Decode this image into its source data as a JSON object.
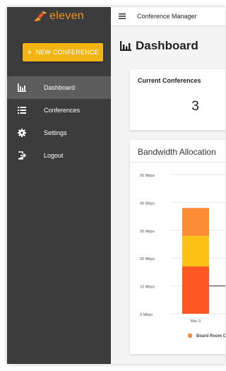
{
  "app": {
    "logo_text": "eleven",
    "title": "Conference Manager"
  },
  "sidebar": {
    "new_button_label": "NEW CONFERENCE",
    "items": [
      {
        "label": "Dashboard",
        "icon": "bar-chart-icon",
        "active": true
      },
      {
        "label": "Conferences",
        "icon": "list-icon",
        "active": false
      },
      {
        "label": "Settings",
        "icon": "gear-icon",
        "active": false
      },
      {
        "label": "Logout",
        "icon": "logout-icon",
        "active": false
      }
    ]
  },
  "page": {
    "title": "Dashboard"
  },
  "cards": {
    "current": {
      "title": "Current Conferences",
      "value": "3"
    },
    "bandwidth": {
      "title": "Bandwidth Allocation"
    }
  },
  "chart_data": {
    "type": "bar",
    "stacked": true,
    "title": "Bandwidth Allocation",
    "categories": [
      "Mar 3"
    ],
    "y_ticks": [
      "0 Mbps",
      "10 Mbps",
      "20 Mbps",
      "30 Mbps",
      "40 Mbps",
      "50 Mbps"
    ],
    "ylim": [
      0,
      50
    ],
    "series": [
      {
        "name": "Board Room Co",
        "values": [
          17
        ],
        "color": "#fd5621"
      },
      {
        "values": [
          11
        ],
        "color": "#fdc216"
      },
      {
        "values": [
          10
        ],
        "color": "#fb8b34"
      }
    ],
    "legend_label": "Board Room Co",
    "legend_color": "#fb8b34",
    "reference_line": 10
  },
  "colors": {
    "accent": "#f2b412",
    "sidebar": "#3c3c3c",
    "active_item": "#5d5d5d",
    "logo": "#f7941d"
  }
}
